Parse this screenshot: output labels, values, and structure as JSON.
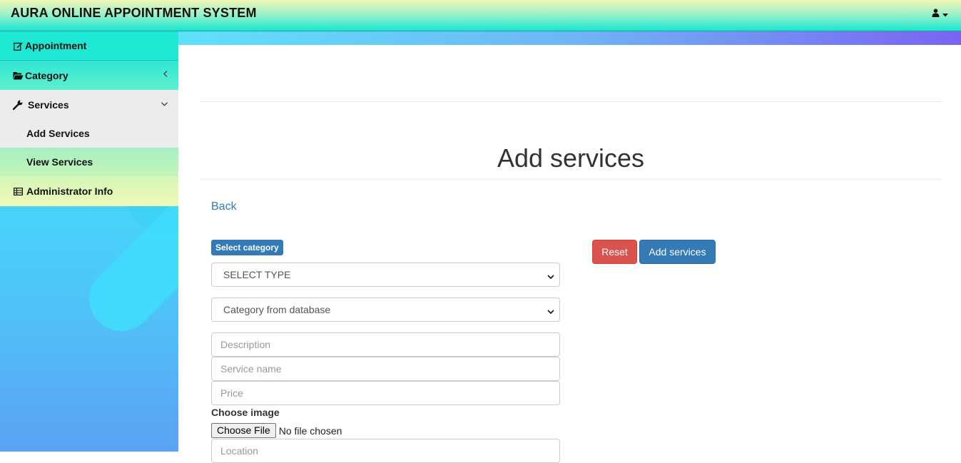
{
  "app": {
    "title": "AURA ONLINE APPOINTMENT SYSTEM"
  },
  "user_menu": {
    "icon": "user-icon",
    "caret_icon": "caret-down-icon"
  },
  "sidebar": {
    "items": [
      {
        "label": "Appointment",
        "icon": "edit-icon"
      },
      {
        "label": "Category",
        "icon": "folder-open-icon",
        "caret": "chevron-left-icon"
      },
      {
        "label": "Services",
        "icon": "wrench-icon",
        "caret": "chevron-down-icon",
        "children": [
          {
            "label": "Add Services"
          },
          {
            "label": "View Services"
          }
        ]
      },
      {
        "label": "Administrator Info",
        "icon": "table-icon"
      }
    ]
  },
  "main": {
    "title": "Add services",
    "back_label": "Back",
    "category_badge": "Select category",
    "type_select": {
      "value": "SELECT TYPE"
    },
    "category_select": {
      "value": "Category from database"
    },
    "description": {
      "placeholder": "Description"
    },
    "service_name": {
      "placeholder": "Service name"
    },
    "price": {
      "placeholder": "Price"
    },
    "image_label": "Choose image",
    "file_button": "Choose File",
    "file_status": "No file chosen",
    "location": {
      "placeholder": "Location"
    },
    "reset_label": "Reset",
    "submit_label": "Add services"
  },
  "colors": {
    "primary": "#337ab7",
    "danger": "#d9534f",
    "navbar_teal": "#18e6d0",
    "sidebar_blue": "#47d6fa"
  }
}
